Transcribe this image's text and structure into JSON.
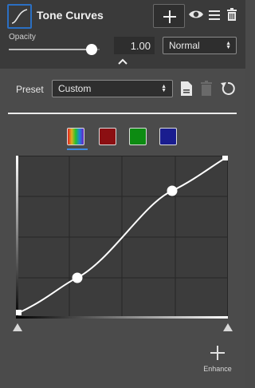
{
  "header": {
    "title": "Tone Curves",
    "icons": [
      "tone-curve-layer-icon",
      "add-icon",
      "eye-icon",
      "menu-icon",
      "trash-icon"
    ]
  },
  "opacity": {
    "label": "Opacity",
    "value": "1.00",
    "fraction": 1.0
  },
  "blend": {
    "selected": "Normal"
  },
  "preset": {
    "label": "Preset",
    "selected": "Custom",
    "icons": [
      "save-preset-icon",
      "delete-preset-icon",
      "reset-icon"
    ]
  },
  "channels": [
    {
      "name": "rgb",
      "selected": true
    },
    {
      "name": "red",
      "color": "#8b0f12"
    },
    {
      "name": "green",
      "color": "#0d8b12"
    },
    {
      "name": "blue",
      "color": "#1a1d8f"
    }
  ],
  "enhance": {
    "label": "Enhance"
  },
  "colors": {
    "accent": "#2b6fc2",
    "selected_underline": "#3d8ae0"
  }
}
